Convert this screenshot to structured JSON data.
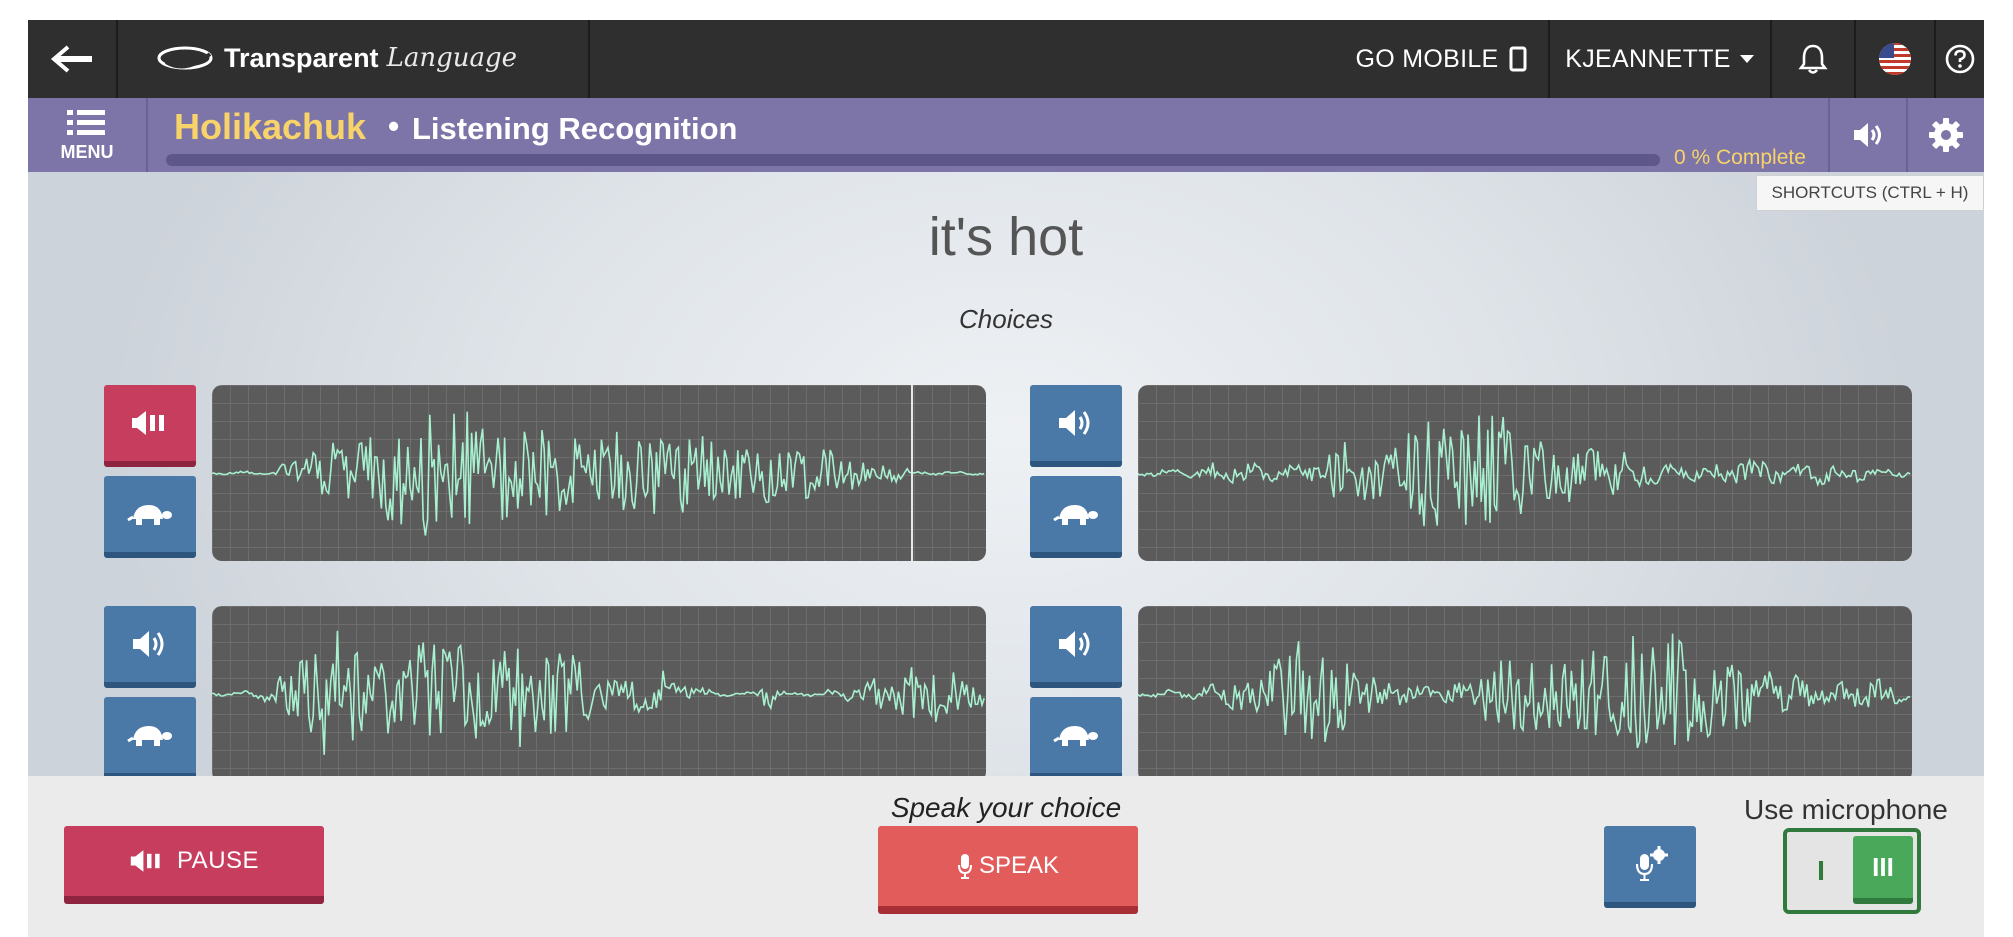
{
  "topbar": {
    "logo_brand": "Transparent",
    "logo_lang": "Language",
    "go_mobile": "GO MOBILE",
    "user": "KJEANNETTE"
  },
  "header": {
    "menu_label": "MENU",
    "language": "Holikachuk",
    "separator": "•",
    "activity": "Listening Recognition",
    "progress_label": "0 % Complete",
    "progress_percent": 0
  },
  "tooltip": {
    "shortcuts": "SHORTCUTS (CTRL + H)"
  },
  "main": {
    "prompt": "it's hot",
    "choices_label": "Choices"
  },
  "bottombar": {
    "pause_label": "PAUSE",
    "speak_prompt": "Speak your choice",
    "speak_label": "SPEAK",
    "use_microphone": "Use microphone",
    "toggle_off": "I",
    "toggle_on": "III"
  },
  "colors": {
    "topbar": "#2f2f2f",
    "header_purple": "#7d74a8",
    "accent_yellow": "#f7d36a",
    "button_blue": "#4a79a8",
    "button_red": "#c73d5e",
    "speak_red": "#e25c5c",
    "wave_green": "#a8f0cf",
    "toggle_green": "#4aa85a"
  },
  "icons": {
    "back": "arrow-left-icon",
    "phone": "phone-icon",
    "bell": "bell-icon",
    "flag": "us-flag-icon",
    "help": "help-icon",
    "menu": "hamburger-icon",
    "audio": "speaker-icon",
    "settings": "gear-icon",
    "slow": "turtle-icon",
    "mic": "microphone-icon",
    "mic_settings": "mic-settings-icon"
  },
  "choices": [
    {
      "id": 1,
      "playing": true
    },
    {
      "id": 2,
      "playing": false
    },
    {
      "id": 3,
      "playing": false
    },
    {
      "id": 4,
      "playing": false
    }
  ]
}
